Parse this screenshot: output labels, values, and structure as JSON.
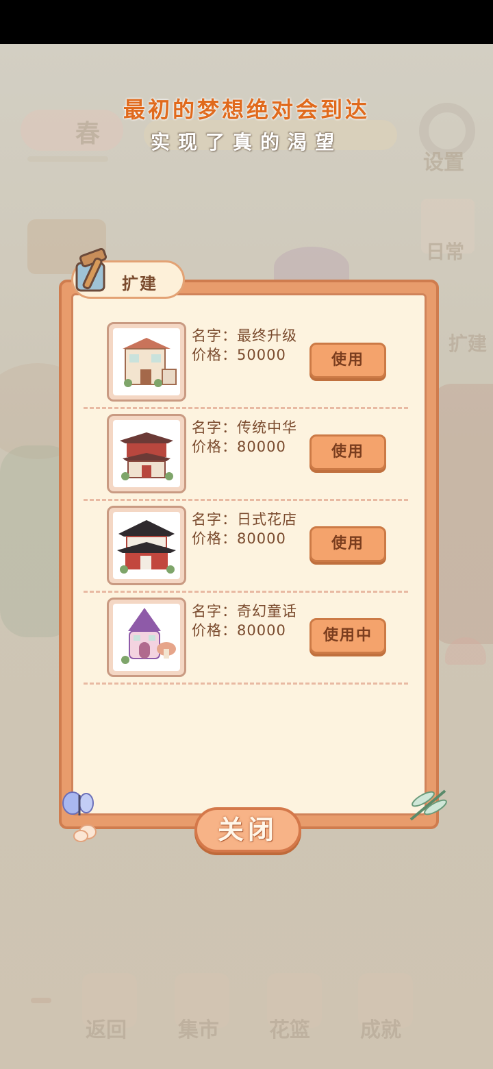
{
  "background": {
    "banner_line1": "最初的梦想绝对会到达",
    "banner_line2": "实现了真的渴望",
    "season_label": "春",
    "top_right_labels": [
      "设置",
      "日常",
      "扩建"
    ],
    "bottom_nav": [
      "返回",
      "集市",
      "花篮",
      "成就"
    ]
  },
  "dialog": {
    "title": "扩建",
    "close_label": "关闭",
    "items": [
      {
        "name": "名字：最终升级",
        "price": "价格：50000",
        "button": "使用"
      },
      {
        "name": "名字：传统中华",
        "price": "价格：80000",
        "button": "使用"
      },
      {
        "name": "名字：日式花店",
        "price": "价格：80000",
        "button": "使用"
      },
      {
        "name": "名字：奇幻童话",
        "price": "价格：80000",
        "button": "使用中"
      }
    ]
  },
  "colors": {
    "accent": "#e89c6c",
    "panel": "#fdf3df",
    "text": "#7a4b2e"
  }
}
